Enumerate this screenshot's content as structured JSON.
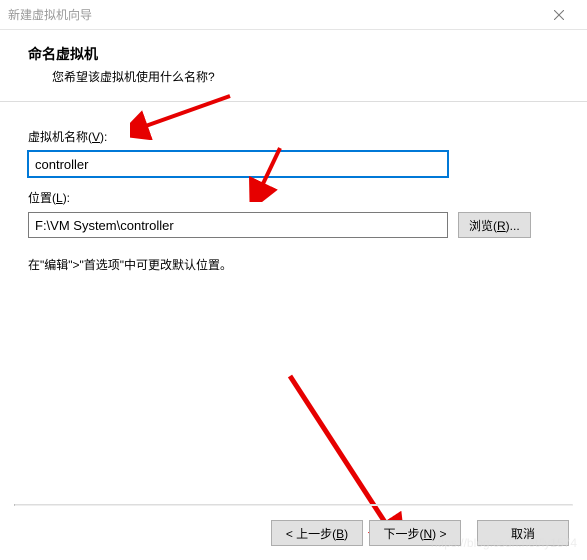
{
  "window": {
    "title": "新建虚拟机向导"
  },
  "header": {
    "title": "命名虚拟机",
    "subtitle": "您希望该虚拟机使用什么名称?"
  },
  "form": {
    "name_label_prefix": "虚拟机名称(",
    "name_label_key": "V",
    "name_label_suffix": "):",
    "name_value": "controller",
    "location_label_prefix": "位置(",
    "location_label_key": "L",
    "location_label_suffix": "):",
    "location_value": "F:\\VM System\\controller",
    "browse_prefix": "浏览(",
    "browse_key": "R",
    "browse_suffix": ")...",
    "note": "在\"编辑\">\"首选项\"中可更改默认位置。"
  },
  "buttons": {
    "back_prefix": "< 上一步(",
    "back_key": "B",
    "back_suffix": ")",
    "next_prefix": "下一步(",
    "next_key": "N",
    "next_suffix": ") >",
    "cancel": "取消"
  },
  "watermark": "https://blog.csdn.net/ly1574"
}
